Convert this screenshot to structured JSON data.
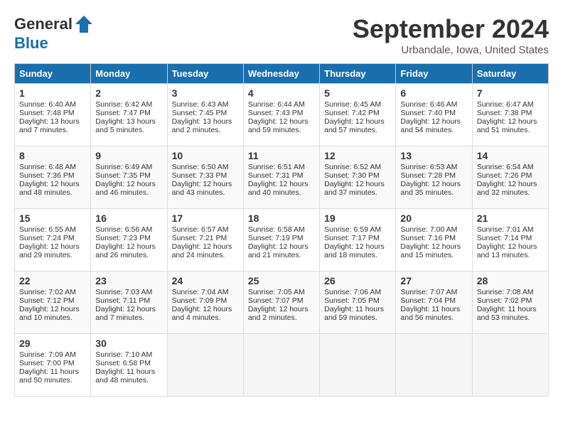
{
  "header": {
    "logo_general": "General",
    "logo_blue": "Blue",
    "month_title": "September 2024",
    "location": "Urbandale, Iowa, United States"
  },
  "days_of_week": [
    "Sunday",
    "Monday",
    "Tuesday",
    "Wednesday",
    "Thursday",
    "Friday",
    "Saturday"
  ],
  "weeks": [
    [
      {
        "day": "1",
        "sunrise": "Sunrise: 6:40 AM",
        "sunset": "Sunset: 7:48 PM",
        "daylight": "Daylight: 13 hours and 7 minutes."
      },
      {
        "day": "2",
        "sunrise": "Sunrise: 6:42 AM",
        "sunset": "Sunset: 7:47 PM",
        "daylight": "Daylight: 13 hours and 5 minutes."
      },
      {
        "day": "3",
        "sunrise": "Sunrise: 6:43 AM",
        "sunset": "Sunset: 7:45 PM",
        "daylight": "Daylight: 13 hours and 2 minutes."
      },
      {
        "day": "4",
        "sunrise": "Sunrise: 6:44 AM",
        "sunset": "Sunset: 7:43 PM",
        "daylight": "Daylight: 12 hours and 59 minutes."
      },
      {
        "day": "5",
        "sunrise": "Sunrise: 6:45 AM",
        "sunset": "Sunset: 7:42 PM",
        "daylight": "Daylight: 12 hours and 57 minutes."
      },
      {
        "day": "6",
        "sunrise": "Sunrise: 6:46 AM",
        "sunset": "Sunset: 7:40 PM",
        "daylight": "Daylight: 12 hours and 54 minutes."
      },
      {
        "day": "7",
        "sunrise": "Sunrise: 6:47 AM",
        "sunset": "Sunset: 7:38 PM",
        "daylight": "Daylight: 12 hours and 51 minutes."
      }
    ],
    [
      {
        "day": "8",
        "sunrise": "Sunrise: 6:48 AM",
        "sunset": "Sunset: 7:36 PM",
        "daylight": "Daylight: 12 hours and 48 minutes."
      },
      {
        "day": "9",
        "sunrise": "Sunrise: 6:49 AM",
        "sunset": "Sunset: 7:35 PM",
        "daylight": "Daylight: 12 hours and 46 minutes."
      },
      {
        "day": "10",
        "sunrise": "Sunrise: 6:50 AM",
        "sunset": "Sunset: 7:33 PM",
        "daylight": "Daylight: 12 hours and 43 minutes."
      },
      {
        "day": "11",
        "sunrise": "Sunrise: 6:51 AM",
        "sunset": "Sunset: 7:31 PM",
        "daylight": "Daylight: 12 hours and 40 minutes."
      },
      {
        "day": "12",
        "sunrise": "Sunrise: 6:52 AM",
        "sunset": "Sunset: 7:30 PM",
        "daylight": "Daylight: 12 hours and 37 minutes."
      },
      {
        "day": "13",
        "sunrise": "Sunrise: 6:53 AM",
        "sunset": "Sunset: 7:28 PM",
        "daylight": "Daylight: 12 hours and 35 minutes."
      },
      {
        "day": "14",
        "sunrise": "Sunrise: 6:54 AM",
        "sunset": "Sunset: 7:26 PM",
        "daylight": "Daylight: 12 hours and 32 minutes."
      }
    ],
    [
      {
        "day": "15",
        "sunrise": "Sunrise: 6:55 AM",
        "sunset": "Sunset: 7:24 PM",
        "daylight": "Daylight: 12 hours and 29 minutes."
      },
      {
        "day": "16",
        "sunrise": "Sunrise: 6:56 AM",
        "sunset": "Sunset: 7:23 PM",
        "daylight": "Daylight: 12 hours and 26 minutes."
      },
      {
        "day": "17",
        "sunrise": "Sunrise: 6:57 AM",
        "sunset": "Sunset: 7:21 PM",
        "daylight": "Daylight: 12 hours and 24 minutes."
      },
      {
        "day": "18",
        "sunrise": "Sunrise: 6:58 AM",
        "sunset": "Sunset: 7:19 PM",
        "daylight": "Daylight: 12 hours and 21 minutes."
      },
      {
        "day": "19",
        "sunrise": "Sunrise: 6:59 AM",
        "sunset": "Sunset: 7:17 PM",
        "daylight": "Daylight: 12 hours and 18 minutes."
      },
      {
        "day": "20",
        "sunrise": "Sunrise: 7:00 AM",
        "sunset": "Sunset: 7:16 PM",
        "daylight": "Daylight: 12 hours and 15 minutes."
      },
      {
        "day": "21",
        "sunrise": "Sunrise: 7:01 AM",
        "sunset": "Sunset: 7:14 PM",
        "daylight": "Daylight: 12 hours and 13 minutes."
      }
    ],
    [
      {
        "day": "22",
        "sunrise": "Sunrise: 7:02 AM",
        "sunset": "Sunset: 7:12 PM",
        "daylight": "Daylight: 12 hours and 10 minutes."
      },
      {
        "day": "23",
        "sunrise": "Sunrise: 7:03 AM",
        "sunset": "Sunset: 7:11 PM",
        "daylight": "Daylight: 12 hours and 7 minutes."
      },
      {
        "day": "24",
        "sunrise": "Sunrise: 7:04 AM",
        "sunset": "Sunset: 7:09 PM",
        "daylight": "Daylight: 12 hours and 4 minutes."
      },
      {
        "day": "25",
        "sunrise": "Sunrise: 7:05 AM",
        "sunset": "Sunset: 7:07 PM",
        "daylight": "Daylight: 12 hours and 2 minutes."
      },
      {
        "day": "26",
        "sunrise": "Sunrise: 7:06 AM",
        "sunset": "Sunset: 7:05 PM",
        "daylight": "Daylight: 11 hours and 59 minutes."
      },
      {
        "day": "27",
        "sunrise": "Sunrise: 7:07 AM",
        "sunset": "Sunset: 7:04 PM",
        "daylight": "Daylight: 11 hours and 56 minutes."
      },
      {
        "day": "28",
        "sunrise": "Sunrise: 7:08 AM",
        "sunset": "Sunset: 7:02 PM",
        "daylight": "Daylight: 11 hours and 53 minutes."
      }
    ],
    [
      {
        "day": "29",
        "sunrise": "Sunrise: 7:09 AM",
        "sunset": "Sunset: 7:00 PM",
        "daylight": "Daylight: 11 hours and 50 minutes."
      },
      {
        "day": "30",
        "sunrise": "Sunrise: 7:10 AM",
        "sunset": "Sunset: 6:58 PM",
        "daylight": "Daylight: 11 hours and 48 minutes."
      },
      null,
      null,
      null,
      null,
      null
    ]
  ]
}
